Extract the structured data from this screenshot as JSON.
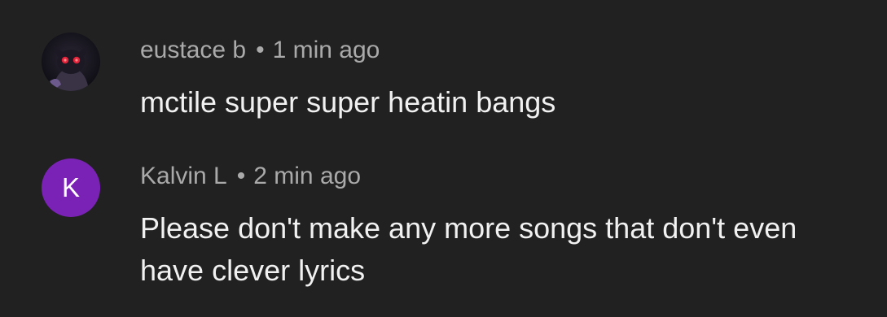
{
  "comments": [
    {
      "author": "eustace b",
      "separator": "•",
      "time": "1 min ago",
      "text": "mctile super super heatin bangs",
      "avatar_type": "image",
      "avatar_icon": "dark-character-avatar-icon"
    },
    {
      "author": "Kalvin L",
      "separator": "•",
      "time": "2 min ago",
      "text": "Please don't make any more songs that don't even have clever lyrics",
      "avatar_type": "letter",
      "avatar_letter": "K",
      "avatar_color": "#7b22b6"
    }
  ],
  "theme": {
    "background": "#212121",
    "meta_color": "#aaaaaa",
    "text_color": "#f1f1f1"
  }
}
